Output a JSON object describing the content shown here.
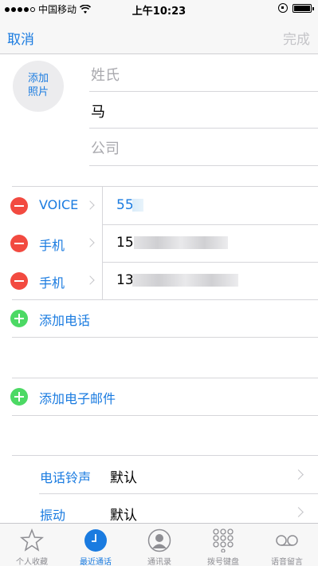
{
  "status_bar": {
    "carrier": "中国移动",
    "time": "上午10:23"
  },
  "nav": {
    "cancel": "取消",
    "done": "完成"
  },
  "photo": {
    "label": "添加\n照片"
  },
  "name_fields": {
    "last_name_placeholder": "姓氏",
    "first_name": "马",
    "company_placeholder": "公司"
  },
  "phones": [
    {
      "label": "VOICE",
      "value": "55"
    },
    {
      "label": "手机",
      "value": "15"
    },
    {
      "label": "手机",
      "value": "13"
    }
  ],
  "add_phone": "添加电话",
  "add_email": "添加电子邮件",
  "settings": [
    {
      "label": "电话铃声",
      "value": "默认"
    },
    {
      "label": "振动",
      "value": "默认"
    }
  ],
  "tabs": [
    {
      "label": "个人收藏",
      "icon": "star-icon",
      "active": false
    },
    {
      "label": "最近通话",
      "icon": "clock-icon",
      "active": true
    },
    {
      "label": "通讯录",
      "icon": "contacts-icon",
      "active": false
    },
    {
      "label": "拨号键盘",
      "icon": "keypad-icon",
      "active": false
    },
    {
      "label": "语音留言",
      "icon": "voicemail-icon",
      "active": false
    }
  ],
  "colors": {
    "accent": "#1a7be0",
    "delete": "#f24a40",
    "add": "#4cd964",
    "disabled": "#c4c4c8"
  }
}
